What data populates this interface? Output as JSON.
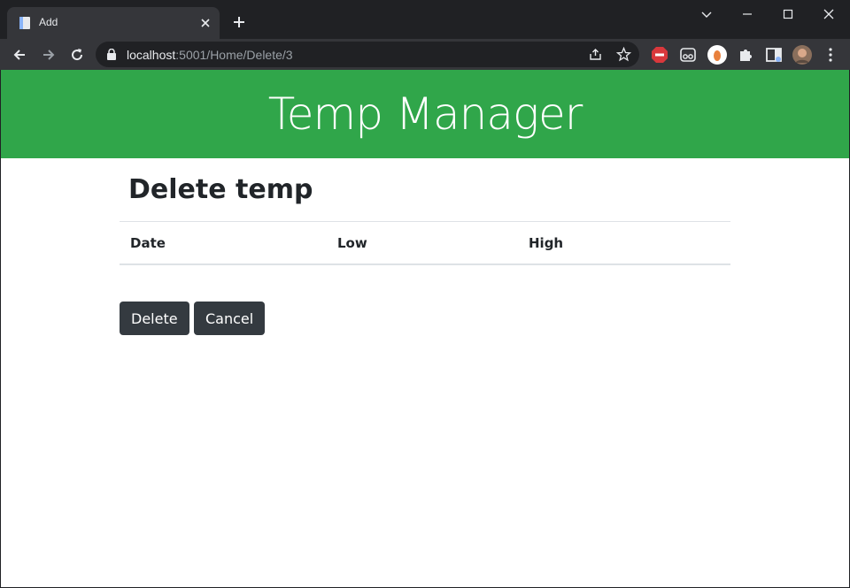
{
  "browser": {
    "tab_title": "Add",
    "url_host": "localhost",
    "url_path": ":5001/Home/Delete/3"
  },
  "header": {
    "title": "Temp Manager"
  },
  "page": {
    "title": "Delete temp",
    "table": {
      "columns": [
        "Date",
        "Low",
        "High"
      ]
    },
    "buttons": {
      "delete": "Delete",
      "cancel": "Cancel"
    }
  },
  "colors": {
    "brand": "#30a64a",
    "button": "#343a40"
  }
}
